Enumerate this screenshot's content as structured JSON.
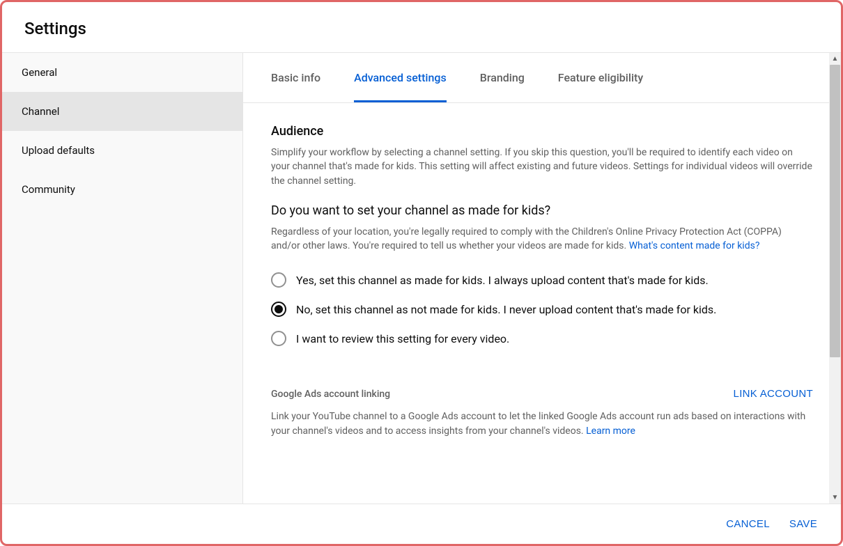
{
  "title": "Settings",
  "sidebar": {
    "items": [
      {
        "label": "General",
        "active": false
      },
      {
        "label": "Channel",
        "active": true
      },
      {
        "label": "Upload defaults",
        "active": false
      },
      {
        "label": "Community",
        "active": false
      }
    ]
  },
  "tabs": [
    {
      "label": "Basic info",
      "active": false
    },
    {
      "label": "Advanced settings",
      "active": true
    },
    {
      "label": "Branding",
      "active": false
    },
    {
      "label": "Feature eligibility",
      "active": false
    }
  ],
  "audience": {
    "heading": "Audience",
    "desc": "Simplify your workflow by selecting a channel setting. If you skip this question, you'll be required to identify each video on your channel that's made for kids. This setting will affect existing and future videos. Settings for individual videos will override the channel setting.",
    "question": "Do you want to set your channel as made for kids?",
    "legal_prefix": "Regardless of your location, you're legally required to comply with the Children's Online Privacy Protection Act (COPPA) and/or other laws. You're required to tell us whether your videos are made for kids. ",
    "legal_link": "What's content made for kids?",
    "options": [
      {
        "label": "Yes, set this channel as made for kids. I always upload content that's made for kids.",
        "checked": false
      },
      {
        "label": "No, set this channel as not made for kids. I never upload content that's made for kids.",
        "checked": true
      },
      {
        "label": "I want to review this setting for every video.",
        "checked": false
      }
    ]
  },
  "ads_linking": {
    "title": "Google Ads account linking",
    "button": "LINK ACCOUNT",
    "desc_prefix": "Link your YouTube channel to a Google Ads account to let the linked Google Ads account run ads based on interactions with your channel's videos and to access insights from your channel's videos. ",
    "desc_link": "Learn more"
  },
  "footer": {
    "cancel": "CANCEL",
    "save": "SAVE"
  }
}
